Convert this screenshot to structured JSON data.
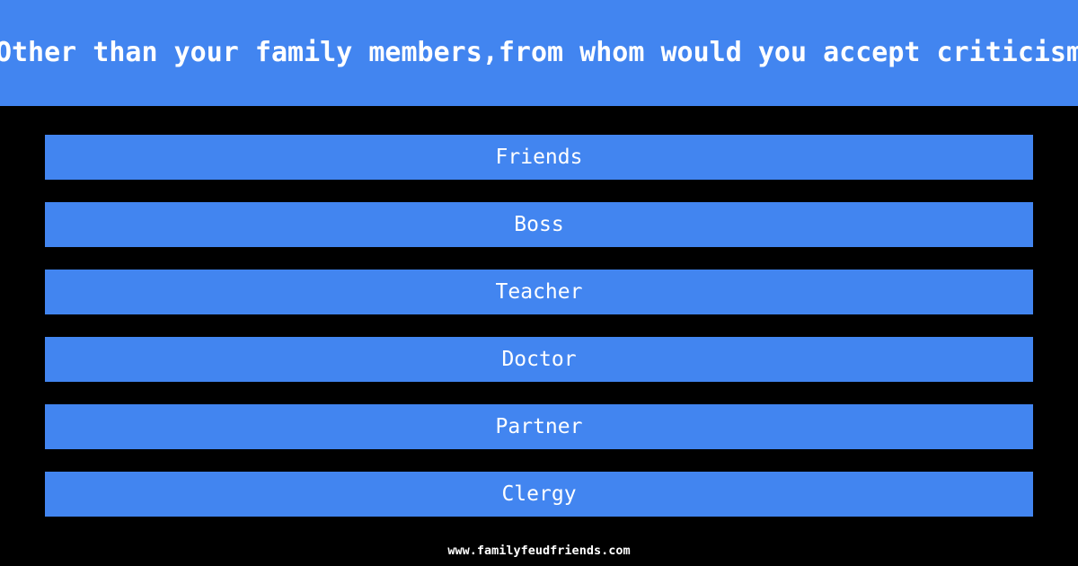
{
  "theme": {
    "background_color": "#000000",
    "accent_color": "#4285f0",
    "text_color": "#ffffff"
  },
  "header": {
    "question": "Other than your family members,from whom would you accept criticism"
  },
  "answers": [
    {
      "label": "Friends"
    },
    {
      "label": "Boss"
    },
    {
      "label": "Teacher"
    },
    {
      "label": "Doctor"
    },
    {
      "label": "Partner"
    },
    {
      "label": "Clergy"
    }
  ],
  "footer": {
    "url": "www.familyfeudfriends.com"
  }
}
